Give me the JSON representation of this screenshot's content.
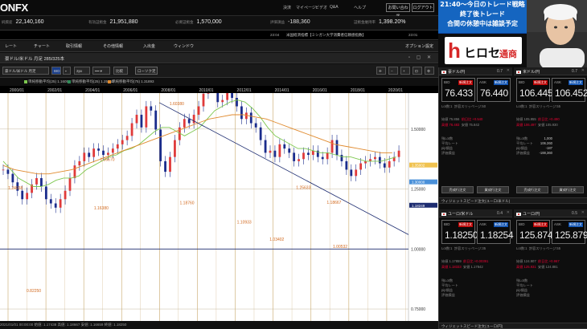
{
  "app": {
    "logo": "ONFX"
  },
  "topnav": [
    "ヘルプ",
    "ログアウト"
  ],
  "topnav_right": [
    "決済",
    "マイページ",
    "ビデオ",
    "Q&A"
  ],
  "top_buttons": {
    "trade": "お問い合わせ",
    "logout": "ログアウト"
  },
  "account": [
    {
      "label": "純資産",
      "value": "22,140,160"
    },
    {
      "label": "有効証拠金",
      "value": "21,951,880"
    },
    {
      "label": "必要証拠金",
      "value": "1,570,000"
    },
    {
      "label": "評価損益",
      "value": "-188,360"
    },
    {
      "label": "証拠金維持率",
      "value": "1,398.20%"
    }
  ],
  "news": {
    "time": "23:04",
    "text": "米国経済指標【ミシガン大学消費者信頼感指数】",
    "clock": "23:01"
  },
  "menu": [
    "レート",
    "チャート",
    "取引情報",
    "その他情報",
    "入出金",
    "ウィンドウ"
  ],
  "options_menu": "オプション設定",
  "chart_title": "豪ドル/米ドル 月足 285/325本",
  "toolbar": {
    "symbol": "豪ドル/米ドル 月足",
    "bid": "BID",
    "period": "2px",
    "compare": "比較",
    "type": "ローソク足",
    "new_window": "全画面"
  },
  "indicators": [
    {
      "label": "単純移動平均(25) 1.16059",
      "color": "#7ec850"
    },
    {
      "label": "単純移動平均(25) 1.25852",
      "color": "#2e8b57"
    },
    {
      "label": "単純移動平均(75) 1.31893",
      "color": "#e08a2e"
    }
  ],
  "chart_data": {
    "type": "line",
    "title": "",
    "x": [
      "2000/01",
      "2002/01",
      "2004/01",
      "2006/01",
      "2008/01",
      "2010/01",
      "2012/01",
      "2014/01",
      "2016/01",
      "2018/01",
      "2020/01"
    ],
    "ylim": [
      0.7,
      1.65
    ],
    "yticks": [
      "1.50000",
      "1.25000",
      "1.00000",
      "0.75000"
    ],
    "price_labels": [
      "1.35002",
      "1.30000",
      "1.18249"
    ],
    "annotations": [
      {
        "label": "1.60380",
        "x": 0.415,
        "y": 1.6
      },
      {
        "label": "1.36670",
        "x": 0.245,
        "y": 1.368
      },
      {
        "label": "1.18760",
        "x": 0.44,
        "y": 1.187
      },
      {
        "label": "1.16380",
        "x": 0.23,
        "y": 1.165
      },
      {
        "label": "1.10933",
        "x": 0.58,
        "y": 1.107
      },
      {
        "label": "1.25633",
        "x": 0.725,
        "y": 1.25
      },
      {
        "label": "1.03402",
        "x": 0.66,
        "y": 1.035
      },
      {
        "label": "1.00532",
        "x": 0.815,
        "y": 1.005
      },
      {
        "label": "1.18667",
        "x": 0.8,
        "y": 1.189
      },
      {
        "label": "0.82250",
        "x": 0.065,
        "y": 0.82
      },
      {
        "label": "1.24938",
        "x": 0.02,
        "y": 1.249
      }
    ],
    "series": [
      {
        "name": "price",
        "values": [
          0.66,
          0.64,
          0.6,
          0.56,
          0.52,
          0.55,
          0.59,
          0.62,
          0.58,
          0.52,
          0.5,
          0.48,
          0.52,
          0.56,
          0.62,
          0.68,
          0.7,
          0.74,
          0.72,
          0.76,
          0.75,
          0.73,
          0.74,
          0.76,
          0.78,
          0.8,
          0.82,
          0.88,
          0.92,
          0.86,
          0.96,
          0.94,
          0.85,
          0.7,
          0.65,
          0.72,
          0.8,
          0.86,
          0.9,
          0.88,
          0.92,
          0.96,
          1.02,
          1.08,
          1.05,
          0.98,
          0.99,
          1.04,
          1.0,
          0.96,
          0.9,
          0.93,
          0.88,
          0.86,
          0.8,
          0.74,
          0.75,
          0.72,
          0.78,
          0.76,
          0.74,
          0.7,
          0.71,
          0.74,
          0.73,
          0.75,
          0.72,
          0.71,
          0.74,
          0.8,
          0.73,
          0.7,
          0.66,
          0.63,
          0.66,
          0.69,
          0.7,
          0.71,
          0.72,
          0.69,
          0.67,
          0.7,
          0.72,
          0.75
        ]
      },
      {
        "name": "ma25",
        "values": [
          0.7,
          0.66,
          0.62,
          0.6,
          0.58,
          0.58,
          0.59,
          0.61,
          0.62,
          0.62,
          0.63,
          0.66,
          0.68,
          0.7,
          0.72,
          0.73,
          0.75,
          0.76,
          0.78,
          0.81,
          0.84,
          0.86,
          0.86,
          0.84,
          0.82,
          0.84,
          0.86,
          0.9,
          0.94,
          0.96,
          0.98,
          0.99,
          0.98,
          0.95,
          0.91,
          0.86,
          0.82,
          0.8,
          0.78,
          0.76,
          0.76,
          0.75,
          0.74,
          0.74,
          0.73,
          0.72,
          0.72,
          0.71,
          0.7,
          0.7,
          0.7,
          0.71,
          0.72
        ]
      },
      {
        "name": "ma75",
        "values": [
          0.68,
          0.66,
          0.65,
          0.64,
          0.64,
          0.65,
          0.66,
          0.68,
          0.7,
          0.72,
          0.74,
          0.76,
          0.78,
          0.8,
          0.82,
          0.84,
          0.86,
          0.88,
          0.9,
          0.91,
          0.92,
          0.92,
          0.91,
          0.9,
          0.88,
          0.86,
          0.84,
          0.82,
          0.8,
          0.78,
          0.77,
          0.76,
          0.75,
          0.74,
          0.74
        ]
      }
    ]
  },
  "status": "2021/01/01 00:00:00  始値: 1.17438  高値: 1.18667  安値: 1.16659  終値: 1.18250",
  "banner": [
    "21:40～今日のトレード戦略",
    "終了後トレード",
    "合間の休憩中は雑談予定"
  ],
  "brand": {
    "h": "h",
    "text": "ヒロセ",
    "text2": "通商"
  },
  "panes": [
    {
      "title": "豪ドル/円",
      "num": "0.7",
      "bid_label": "BID",
      "ask_label": "ASK",
      "bid_tag": "新規注文",
      "ask_tag": "新規注文",
      "bid": "76.433",
      "ask": "76.440",
      "spread": "0.7",
      "info": [
        "Lot数:1",
        "許容スリッページ:50"
      ],
      "lowhigh": [
        "始値 75.856",
        "前日比 +0.540",
        "高値 76.483",
        "安値 75.842"
      ],
      "buttons": [
        "売成行注文",
        "買成行注文"
      ],
      "stats": [
        [
          "残Lot数",
          ""
        ],
        [
          "平均レート",
          ""
        ],
        [
          "pip損益",
          ""
        ],
        [
          "評価損益",
          ""
        ]
      ]
    },
    {
      "title": "米ドル/円",
      "num": "0.7",
      "bid_label": "BID",
      "ask_label": "ASK",
      "bid_tag": "新規注文",
      "ask_tag": "新規注文",
      "bid": "106.445",
      "ask": "106.452",
      "spread": "0.7",
      "info": [
        "Lot数:1",
        "許容スリッページ:55"
      ],
      "lowhigh": [
        "始値 105.955",
        "前日比 +0.490",
        "高値 106.497",
        "安値 105.930"
      ],
      "buttons": [
        "売成行注文",
        "買成行注文"
      ],
      "stats": [
        [
          "残Lot数",
          "1,000"
        ],
        [
          "平均レート",
          "106.260"
        ],
        [
          "pip損益",
          "-187"
        ],
        [
          "評価損益",
          "-188,360"
        ]
      ]
    },
    {
      "title": "ユーロ/米ドル",
      "num": "0.4",
      "bid_label": "BID",
      "ask_label": "ASK",
      "bid_tag": "新規注文",
      "ask_tag": "新規注文",
      "bid": "1.18250",
      "ask": "1.18254",
      "spread": "0.4",
      "info": [
        "Lot数:1",
        "許容スリッページ:35"
      ],
      "lowhigh": [
        "始値 1.17859",
        "前日比 +0.00391",
        "高値 1.18333",
        "安値 1.17842"
      ],
      "buttons": [
        "売成行注文",
        "買成行注文"
      ],
      "stats": [
        [
          "残Lot数",
          ""
        ],
        [
          "平均レート",
          ""
        ],
        [
          "pip損益",
          ""
        ],
        [
          "評価損益",
          ""
        ]
      ]
    },
    {
      "title": "ユーロ/円",
      "num": "0.5",
      "bid_label": "BID",
      "ask_label": "ASK",
      "bid_tag": "新規注文",
      "ask_tag": "新規注文",
      "bid": "125.874",
      "ask": "125.879",
      "spread": "0.5",
      "info": [
        "Lot数:1",
        "許容スリッページ:55"
      ],
      "lowhigh": [
        "始値 124.907",
        "前日比 +0.967",
        "高値 125.931",
        "安値 124.881"
      ],
      "buttons": [
        "売成行注文",
        "買成行注文"
      ],
      "stats": [
        [
          "残Lot数",
          ""
        ],
        [
          "平均レート",
          ""
        ],
        [
          "pip損益",
          ""
        ],
        [
          "評価損益",
          ""
        ]
      ]
    }
  ],
  "section_bars": [
    "ウィジェットスピード注文(ユーロ/米ドル)",
    "ウィジェットスピード注文(ユーロ/円)"
  ]
}
